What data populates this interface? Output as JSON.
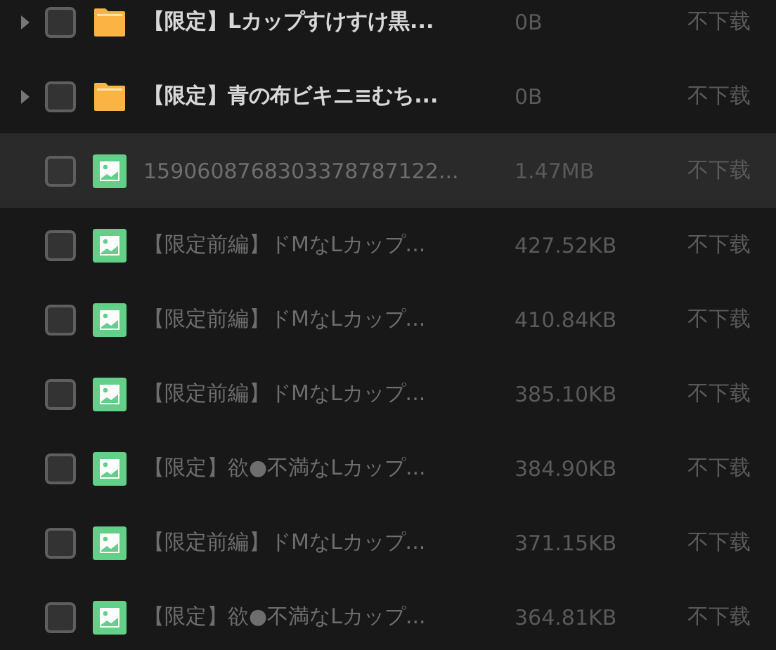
{
  "files": [
    {
      "kind": "folder",
      "name": "【限定】Lカップすけすけ黒...",
      "size": "0B",
      "status": "不下载",
      "checked": false,
      "selected": false,
      "expanded": false
    },
    {
      "kind": "folder",
      "name": "【限定】青の布ビキニ≡むち...",
      "size": "0B",
      "status": "不下载",
      "checked": false,
      "selected": false,
      "expanded": false
    },
    {
      "kind": "image",
      "name": "1590608768303378787122...",
      "size": "1.47MB",
      "status": "不下载",
      "checked": false,
      "selected": true
    },
    {
      "kind": "image",
      "name": "【限定前編】ドMなLカップ...",
      "size": "427.52KB",
      "status": "不下载",
      "checked": false,
      "selected": false
    },
    {
      "kind": "image",
      "name": "【限定前編】ドMなLカップ...",
      "size": "410.84KB",
      "status": "不下载",
      "checked": false,
      "selected": false
    },
    {
      "kind": "image",
      "name": "【限定前編】ドMなLカップ...",
      "size": "385.10KB",
      "status": "不下载",
      "checked": false,
      "selected": false
    },
    {
      "kind": "image",
      "name": "【限定】欲●不満なLカップ...",
      "size": "384.90KB",
      "status": "不下载",
      "checked": false,
      "selected": false
    },
    {
      "kind": "image",
      "name": "【限定前編】ドMなLカップ...",
      "size": "371.15KB",
      "status": "不下载",
      "checked": false,
      "selected": false
    },
    {
      "kind": "image",
      "name": "【限定】欲●不満なLカップ...",
      "size": "364.81KB",
      "status": "不下载",
      "checked": false,
      "selected": false
    }
  ]
}
